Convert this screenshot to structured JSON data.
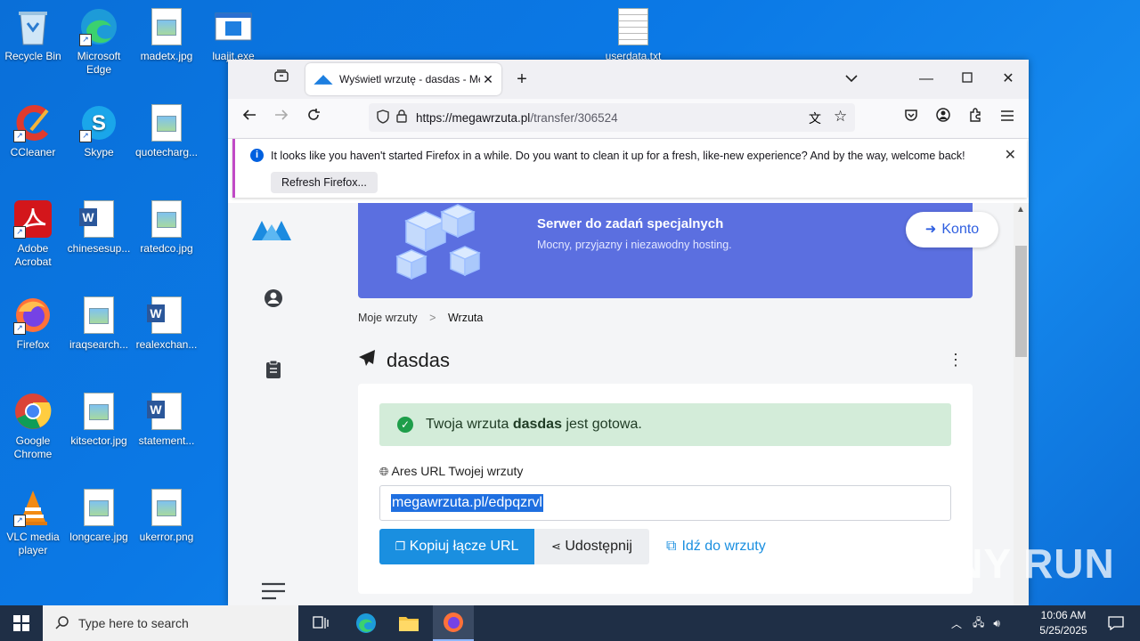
{
  "desktop": {
    "icons": [
      {
        "label": "Recycle Bin"
      },
      {
        "label": "Microsoft Edge"
      },
      {
        "label": "madetx.jpg"
      },
      {
        "label": "luajit.exe"
      },
      {
        "label": "userdata.txt"
      },
      {
        "label": "CCleaner"
      },
      {
        "label": "Skype"
      },
      {
        "label": "quotecharg..."
      },
      {
        "label": "Adobe Acrobat"
      },
      {
        "label": "chinesesup..."
      },
      {
        "label": "ratedco.jpg"
      },
      {
        "label": "Firefox"
      },
      {
        "label": "iraqsearch..."
      },
      {
        "label": "realexchan..."
      },
      {
        "label": "Google Chrome"
      },
      {
        "label": "kitsector.jpg"
      },
      {
        "label": "statement..."
      },
      {
        "label": "VLC media player"
      },
      {
        "label": "longcare.jpg"
      },
      {
        "label": "ukerror.png"
      }
    ]
  },
  "browser": {
    "tab_title": "Wyświetl wrzutę - dasdas - Meg",
    "url_host": "https://megawrzuta.pl",
    "url_path": "/transfer/306524",
    "notification": {
      "message": "It looks like you haven't started Firefox in a while. Do you want to clean it up for a fresh, like-new experience? And by the way, welcome back!",
      "button": "Refresh Firefox..."
    }
  },
  "page": {
    "banner_title": "Serwer do zadań specjalnych",
    "banner_subtitle": "Mocny, przyjazny i niezawodny hosting.",
    "konto": "Konto",
    "breadcrumb": {
      "root": "Moje wrzuty",
      "sep": ">",
      "current": "Wrzuta"
    },
    "heading": "dasdas",
    "alert": {
      "prefix": "Twoja wrzuta",
      "name": "dasdas",
      "suffix": "jest gotowa."
    },
    "url_label_bold": "Ares URL",
    "url_label_rest": "Twojej wrzuty",
    "url_value": "megawrzuta.pl/edpqzrvl",
    "copy_button": "Kopiuj łącze URL",
    "share_button": "Udostępnij",
    "go_button": "Idź do wrzuty"
  },
  "taskbar": {
    "search_placeholder": "Type here to search",
    "time": "10:06 AM",
    "date": "5/25/2025"
  },
  "watermark": "ANY RUN"
}
